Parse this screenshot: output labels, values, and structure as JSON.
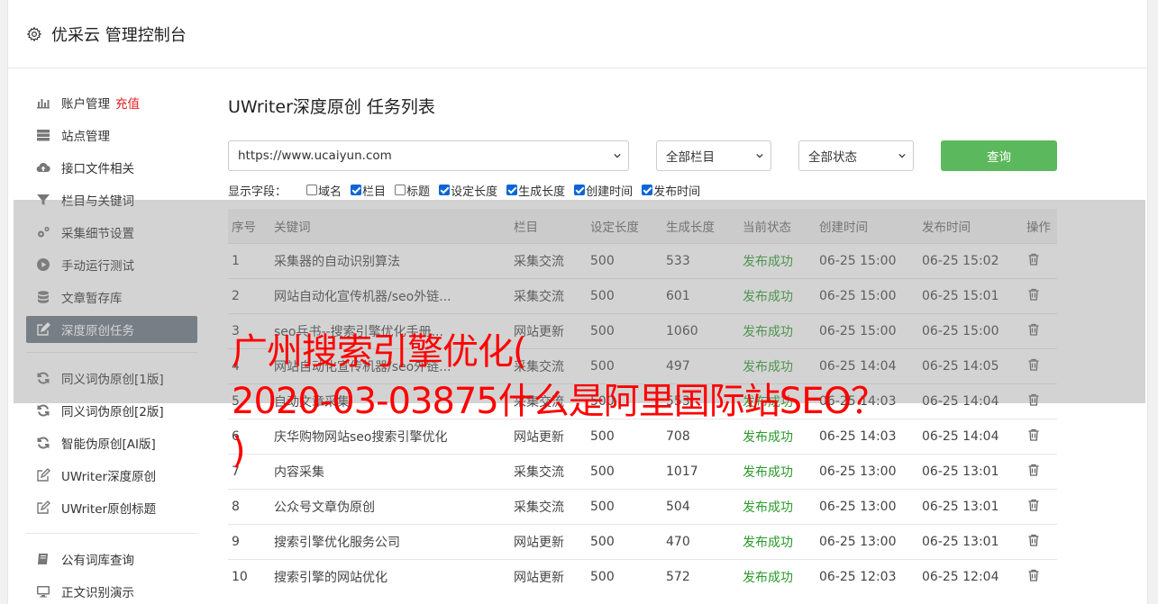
{
  "header": {
    "title": "优采云 管理控制台"
  },
  "sidebar": {
    "items": [
      {
        "label": "账户管理",
        "badge": "充值",
        "icon": "bar-chart-icon"
      },
      {
        "label": "站点管理",
        "icon": "server-icon"
      },
      {
        "label": "接口文件相关",
        "icon": "cloud-upload-icon"
      },
      {
        "label": "栏目与关键词",
        "icon": "filter-icon"
      },
      {
        "label": "采集细节设置",
        "icon": "cogs-icon"
      },
      {
        "label": "手动运行测试",
        "icon": "play-circle-icon"
      },
      {
        "label": "文章暂存库",
        "icon": "database-icon"
      },
      {
        "label": "深度原创任务",
        "icon": "edit-icon"
      }
    ],
    "items2": [
      {
        "label": "同义词伪原创[1版]",
        "icon": "refresh-icon"
      },
      {
        "label": "同义词伪原创[2版]",
        "icon": "refresh-icon"
      },
      {
        "label": "智能伪原创[AI版]",
        "icon": "refresh-icon"
      },
      {
        "label": "UWriter深度原创",
        "icon": "edit-icon"
      },
      {
        "label": "UWriter原创标题",
        "icon": "edit-icon"
      }
    ],
    "items3": [
      {
        "label": "公有词库查询",
        "icon": "book-icon"
      },
      {
        "label": "正文识别演示",
        "icon": "monitor-icon"
      }
    ]
  },
  "main": {
    "title": "UWriter深度原创 任务列表",
    "site_select": "https://www.ucaiyun.com",
    "column_select": "全部栏目",
    "status_select": "全部状态",
    "query_button": "查询",
    "fields_label": "显示字段：",
    "fields": [
      {
        "label": "域名",
        "checked": false
      },
      {
        "label": "栏目",
        "checked": true
      },
      {
        "label": "标题",
        "checked": false
      },
      {
        "label": "设定长度",
        "checked": true
      },
      {
        "label": "生成长度",
        "checked": true
      },
      {
        "label": "创建时间",
        "checked": true
      },
      {
        "label": "发布时间",
        "checked": true
      }
    ],
    "table": {
      "headers": [
        "序号",
        "关键词",
        "栏目",
        "设定长度",
        "生成长度",
        "当前状态",
        "创建时间",
        "发布时间",
        "操作"
      ],
      "rows": [
        [
          "1",
          "采集器的自动识别算法",
          "采集交流",
          "500",
          "533",
          "发布成功",
          "06-25 15:00",
          "06-25 15:02"
        ],
        [
          "2",
          "网站自动化宣传机器/seo外链...",
          "采集交流",
          "500",
          "601",
          "发布成功",
          "06-25 15:00",
          "06-25 15:01"
        ],
        [
          "3",
          "seo兵书--搜索引擎优化手册...",
          "网站更新",
          "500",
          "1060",
          "发布成功",
          "06-25 15:00",
          "06-25 15:00"
        ],
        [
          "4",
          "网站自动化宣传机器/seo外链...",
          "采集交流",
          "500",
          "497",
          "发布成功",
          "06-25 14:04",
          "06-25 14:05"
        ],
        [
          "5",
          "自动文章采集",
          "采集交流",
          "500",
          "553",
          "发布成功",
          "06-25 14:03",
          "06-25 14:04"
        ],
        [
          "6",
          "庆华购物网站seo搜索引擎优化",
          "网站更新",
          "500",
          "708",
          "发布成功",
          "06-25 14:03",
          "06-25 14:04"
        ],
        [
          "7",
          "内容采集",
          "采集交流",
          "500",
          "1017",
          "发布成功",
          "06-25 13:00",
          "06-25 13:01"
        ],
        [
          "8",
          "公众号文章伪原创",
          "采集交流",
          "500",
          "504",
          "发布成功",
          "06-25 13:00",
          "06-25 13:01"
        ],
        [
          "9",
          "搜索引擎优化服务公司",
          "网站更新",
          "500",
          "470",
          "发布成功",
          "06-25 13:00",
          "06-25 13:01"
        ],
        [
          "10",
          "搜索引擎的网站优化",
          "网站更新",
          "500",
          "572",
          "发布成功",
          "06-25 12:03",
          "06-25 12:04"
        ]
      ]
    }
  },
  "overlay": {
    "line1": "广州搜索引擎优化(",
    "line2": "2020-03-03875什么是阿里国际站SEO？",
    "line3": ")"
  },
  "colors": {
    "accent": "#5cb85c",
    "active_nav": "#6c7682",
    "status_ok": "#2a9a2a",
    "badge": "#e02020",
    "overlay_text": "#ff0000"
  }
}
